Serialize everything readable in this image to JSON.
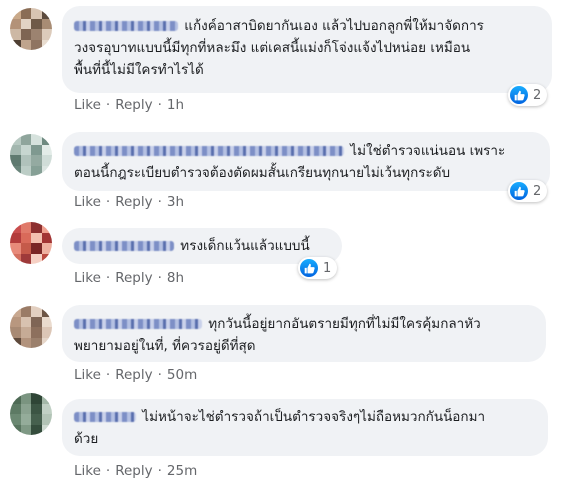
{
  "comments": [
    {
      "text_lines": [
        "แก้งค์อาสาบิดยากันเอง แล้วไปบอกลูกพี่ให้มาจัดการ",
        "วงจรอุบาทแบบนี้มีทุกที่หละมึง แต่เคสนี้แม่งก็โจ่งแจ้งไปหน่อย เหมือน",
        "พื้นที่นี้ไม่มีใครทำไรได้"
      ],
      "like_label": "Like",
      "reply_label": "Reply",
      "time": "1h",
      "reaction_count": "2",
      "reaction_icon": "like-icon",
      "avatar_colors": [
        "#c9a98a",
        "#8a6d55",
        "#d8c4b2",
        "#5c4a3d",
        "#b39278",
        "#e2d3c4",
        "#6f5a48",
        "#a88c74",
        "#cdb8a4",
        "#7e6553",
        "#9c8370",
        "#dccbbb",
        "#4f3f33",
        "#bfa48d",
        "#8f7461",
        "#e8dccf"
      ]
    },
    {
      "text_lines": [
        "ไม่ใช่ตำรวจแน่นอน เพราะ",
        "ตอนนี้กฎระเบียบตำรวจต้องตัดผมสั้นเกรียนทุกนายไม่เว้นทุกระดับ"
      ],
      "like_label": "Like",
      "reply_label": "Reply",
      "time": "3h",
      "reaction_count": "2",
      "reaction_icon": "like-icon",
      "avatar_colors": [
        "#b8c9c2",
        "#8fa59c",
        "#d6e2dd",
        "#6e8a80",
        "#a3b7af",
        "#c7d6d0",
        "#7f9990",
        "#e3ece8",
        "#5f7a70",
        "#b0c2bb",
        "#94aaa1",
        "#d0ddd8",
        "#6a857b",
        "#bccdc6",
        "#86a096",
        "#dbe5e1"
      ]
    },
    {
      "text_lines": [
        "ทรงเด็กแว้นแล้วแบบนี้"
      ],
      "like_label": "Like",
      "reply_label": "Reply",
      "time": "8h",
      "reaction_count": "1",
      "reaction_icon": "like-icon",
      "avatar_colors": [
        "#c94e4e",
        "#e07a6a",
        "#8c2f2f",
        "#f0a090",
        "#b33c3c",
        "#d96a5a",
        "#f3c0b0",
        "#a23434",
        "#e88a7a",
        "#c55a4a",
        "#7a2626",
        "#eeb0a0",
        "#d47060",
        "#9e3a3a",
        "#f6d0c4",
        "#bb4a40"
      ]
    },
    {
      "text_lines": [
        "ทุกวันนี้อยู่ยากอันตรายมีทุกที่ไม่มีใครคุ้มกลาหัว",
        "พยายามอยู่ในที่, ที่ควรอยู่ดีที่สุด"
      ],
      "like_label": "Like",
      "reply_label": "Reply",
      "time": "50m",
      "reaction_count": "",
      "reaction_icon": "",
      "avatar_colors": [
        "#c8a890",
        "#9a7b66",
        "#e2cfc0",
        "#6d5545",
        "#b8977f",
        "#d8c2b0",
        "#7f6555",
        "#eadbce",
        "#a88a74",
        "#c6ab96",
        "#8d705d",
        "#dcc6b6",
        "#5f4a3c",
        "#b2937d",
        "#9b806c",
        "#e6d6c9"
      ]
    },
    {
      "text_lines": [
        "ไม่หน้าจะไช่ตำรวจถ้าเป็นตำรวจจริงๆไม่ถือหมวกกันน็อกมา",
        "ด้วย"
      ],
      "like_label": "Like",
      "reply_label": "Reply",
      "time": "25m",
      "reaction_count": "",
      "reaction_icon": "",
      "avatar_colors": [
        "#4e6a55",
        "#7a9480",
        "#2f4536",
        "#a3b8a8",
        "#5d7a64",
        "#8aa290",
        "#3c5544",
        "#c0d0c4",
        "#6b8872",
        "#94ac9a",
        "#46604e",
        "#b2c4b6",
        "#58745f",
        "#7f9985",
        "#354d3d",
        "#cddad0"
      ]
    }
  ]
}
